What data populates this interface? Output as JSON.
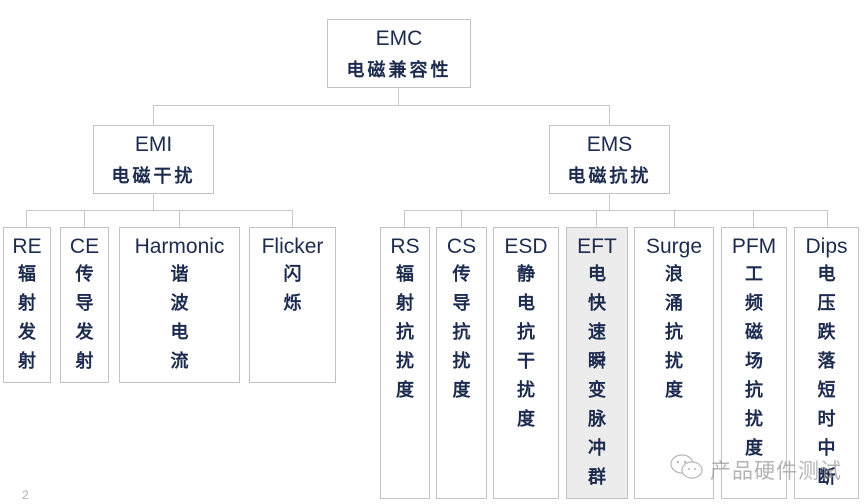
{
  "diagram": {
    "root": {
      "abbr": "EMC",
      "name": "电磁兼容性"
    },
    "branches": [
      {
        "abbr": "EMI",
        "name": "电磁干扰",
        "children": [
          {
            "abbr": "RE",
            "name": "辐射发射"
          },
          {
            "abbr": "CE",
            "name": "传导发射"
          },
          {
            "abbr": "Harmonic",
            "name": "谐波电流"
          },
          {
            "abbr": "Flicker",
            "name": "闪烁"
          }
        ]
      },
      {
        "abbr": "EMS",
        "name": "电磁抗扰",
        "children": [
          {
            "abbr": "RS",
            "name": "辐射抗扰度"
          },
          {
            "abbr": "CS",
            "name": "传导抗扰度"
          },
          {
            "abbr": "ESD",
            "name": "静电抗干扰度"
          },
          {
            "abbr": "EFT",
            "name": "电快速瞬变脉冲群",
            "highlighted": true
          },
          {
            "abbr": "Surge",
            "name": "浪涌抗扰度"
          },
          {
            "abbr": "PFM",
            "name": "工频磁场抗扰度"
          },
          {
            "abbr": "Dips",
            "name": "电压跌落短时中断"
          }
        ]
      }
    ]
  },
  "colors": {
    "text": "#1c2b4e",
    "border": "#c3c3c3",
    "highlight_bg": "#ececec",
    "connector": "#c8c8c8"
  },
  "page_number": "2",
  "watermark": {
    "icon": "wechat-icon",
    "text": "产品硬件测试"
  }
}
